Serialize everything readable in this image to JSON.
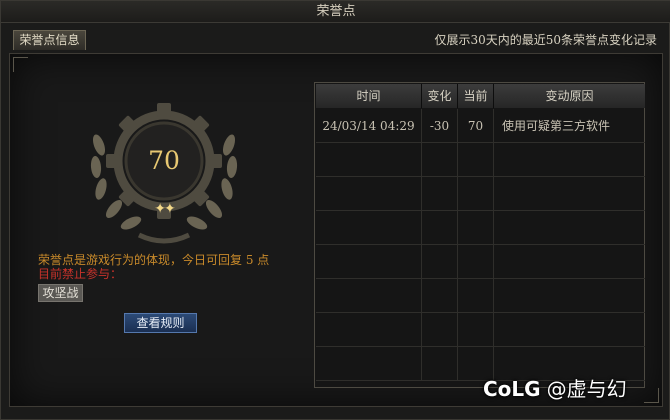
{
  "window": {
    "title": "荣誉点"
  },
  "tab": {
    "label": "荣誉点信息"
  },
  "notice": "仅展示30天内的最近50条荣誉点变化记录",
  "emblem": {
    "score": "70",
    "stars_icon": "sparkle-icon",
    "stars": "✦✦"
  },
  "description": "荣誉点是游戏行为的体现，今日可回复 5 点",
  "ban_text": "目前禁止参与：",
  "banned_activity": "攻坚战",
  "rules_button": "查看规则",
  "table": {
    "headers": {
      "time": "时间",
      "change": "变化",
      "current": "当前",
      "reason": "变动原因"
    },
    "rows": [
      {
        "time": "24/03/14 04:29",
        "change": "-30",
        "current": "70",
        "reason": "使用可疑第三方软件"
      }
    ]
  },
  "watermark": {
    "logo": "CoLG",
    "author": "@虚与幻"
  },
  "colors": {
    "accent_gold": "#e8c872",
    "warning_orange": "#c98a2a",
    "ban_red": "#c8322a",
    "button_blue": "#2c4a76"
  }
}
